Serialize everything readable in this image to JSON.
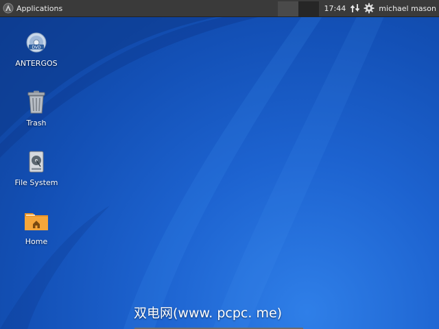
{
  "panel": {
    "applications_label": "Applications",
    "clock": "17:44",
    "user_name": "michael mason",
    "icons": [
      "app-menu-logo-icon",
      "network-transfer-icon",
      "settings-gear-icon"
    ]
  },
  "desktop": {
    "icons": [
      {
        "label": "ANTERGOS",
        "icon": "disc-icon"
      },
      {
        "label": "Trash",
        "icon": "trash-icon"
      },
      {
        "label": "File System",
        "icon": "drive-icon"
      },
      {
        "label": "Home",
        "icon": "home-folder-icon"
      }
    ]
  },
  "watermark": "双电网(www. pcpc. me)",
  "colors": {
    "panel_bg": "#3a3a3a",
    "desktop_blue": "#1d63d0",
    "folder_orange": "#f0a030"
  }
}
